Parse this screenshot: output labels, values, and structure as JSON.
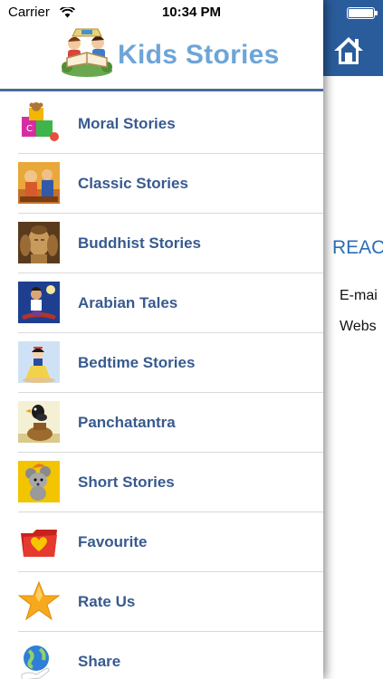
{
  "status_bar": {
    "carrier": "Carrier",
    "time": "10:34 PM"
  },
  "header": {
    "title": "Kids Stories",
    "logo_icon": "children-reading-book-icon"
  },
  "menu": {
    "items": [
      {
        "label": "Moral Stories",
        "icon": "toy-blocks-icon"
      },
      {
        "label": "Classic Stories",
        "icon": "classic-story-thumbnail"
      },
      {
        "label": "Buddhist Stories",
        "icon": "buddha-thumbnail"
      },
      {
        "label": "Arabian Tales",
        "icon": "aladdin-thumbnail"
      },
      {
        "label": "Bedtime Stories",
        "icon": "princess-thumbnail"
      },
      {
        "label": "Panchatantra",
        "icon": "crow-and-pot-thumbnail"
      },
      {
        "label": "Short Stories",
        "icon": "mouse-thumbnail"
      },
      {
        "label": "Favourite",
        "icon": "heart-folder-icon"
      },
      {
        "label": "Rate Us",
        "icon": "star-icon"
      },
      {
        "label": "Share",
        "icon": "globe-share-icon"
      }
    ]
  },
  "main_panel": {
    "heading": "REAC",
    "lines": [
      "E-mai",
      "Webs"
    ]
  },
  "colors": {
    "navbar": "#2a5c9c",
    "title": "#6ea5d8",
    "menu_label": "#385a8f",
    "heading": "#2a6db5"
  }
}
